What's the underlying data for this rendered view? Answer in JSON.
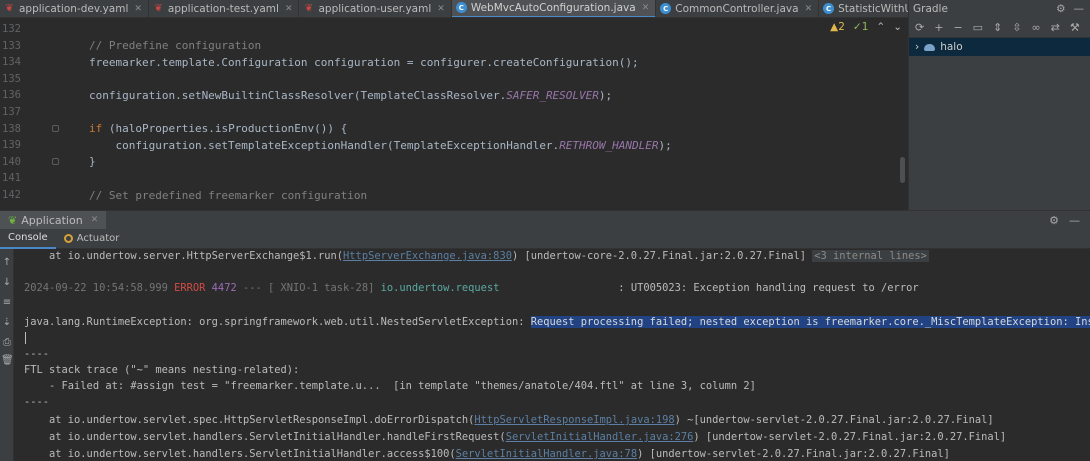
{
  "tabs": [
    {
      "label": "application-dev.yaml",
      "kind": "yaml",
      "active": false
    },
    {
      "label": "application-test.yaml",
      "kind": "yaml",
      "active": false
    },
    {
      "label": "application-user.yaml",
      "kind": "yaml",
      "active": false
    },
    {
      "label": "WebMvcAutoConfiguration.java",
      "kind": "java",
      "active": true
    },
    {
      "label": "CommonController.java",
      "kind": "java",
      "active": false
    },
    {
      "label": "StatisticWithUserDTO.java",
      "kind": "java",
      "active": false
    }
  ],
  "inspections": {
    "warnings": "▲2",
    "weak": "✓1"
  },
  "editor": {
    "lines": [
      {
        "num": "132",
        "html": ""
      },
      {
        "num": "133",
        "code": "        // Predefine configuration",
        "cls": "cmt"
      },
      {
        "num": "134",
        "code": "        freemarker.template.Configuration configuration = configurer.createConfiguration();"
      },
      {
        "num": "135",
        "code": ""
      },
      {
        "num": "136",
        "code": "        configuration.setNewBuiltinClassResolver(TemplateClassResolver.",
        "suffix_italic": "SAFER_RESOLVER",
        "suffix": ");"
      },
      {
        "num": "137",
        "code": ""
      },
      {
        "num": "138",
        "kw": "        if ",
        "code": "(haloProperties.isProductionEnv()) {"
      },
      {
        "num": "139",
        "code": "            configuration.setTemplateExceptionHandler(TemplateExceptionHandler.",
        "suffix_italic": "RETHROW_HANDLER",
        "suffix": ");"
      },
      {
        "num": "140",
        "code": "        }"
      },
      {
        "num": "141",
        "code": ""
      },
      {
        "num": "142",
        "code": "        // Set predefined freemarker configuration",
        "cls": "cmt"
      }
    ]
  },
  "gradle": {
    "title": "Gradle",
    "project": "halo"
  },
  "run": {
    "app_label": "Application",
    "tabs": [
      "Console",
      "Actuator"
    ]
  },
  "console": {
    "l1_prefix": "    at io.undertow.server.HttpServerExchange$1.run(",
    "l1_link": "HttpServerExchange.java:830",
    "l1_mid": ") [undertow-core-2.0.27.Final.jar:2.0.27.Final]",
    "l1_badge": "<3 internal lines>",
    "l2_time": "2024-09-22 10:54:58.999 ",
    "l2_level": "ERROR",
    "l2_pid": " 4472",
    "l2_thread": " --- [ XNIO-1 task-28] ",
    "l2_logger": "io.undertow.request",
    "l2_msg": "                   : UT005023: Exception handling request to /error",
    "l3_prefix": "java.lang.RuntimeException: org.springframework.web.util.NestedServletException: ",
    "l3_sel": "Request processing failed; nested exception is freemarker.core._MiscTemplateException: Instantia",
    "l4": "----",
    "l5": "FTL stack trace (\"~\" means nesting-related):",
    "l6": "    - Failed at: #assign test = \"freemarker.template.u...  [in template \"themes/anatole/404.ftl\" at line 3, column 2]",
    "l7": "----",
    "l8_prefix": "    at io.undertow.servlet.spec.HttpServletResponseImpl.doErrorDispatch(",
    "l8_link": "HttpServletResponseImpl.java:198",
    "l8_suffix": ") ~[undertow-servlet-2.0.27.Final.jar:2.0.27.Final]",
    "l9_prefix": "    at io.undertow.servlet.handlers.ServletInitialHandler.handleFirstRequest(",
    "l9_link": "ServletInitialHandler.java:276",
    "l9_suffix": ") [undertow-servlet-2.0.27.Final.jar:2.0.27.Final]",
    "l10_prefix": "    at io.undertow.servlet.handlers.ServletInitialHandler.access$100(",
    "l10_link": "ServletInitialHandler.java:78",
    "l10_suffix": ") [undertow-servlet-2.0.27.Final.jar:2.0.27.Final]"
  }
}
